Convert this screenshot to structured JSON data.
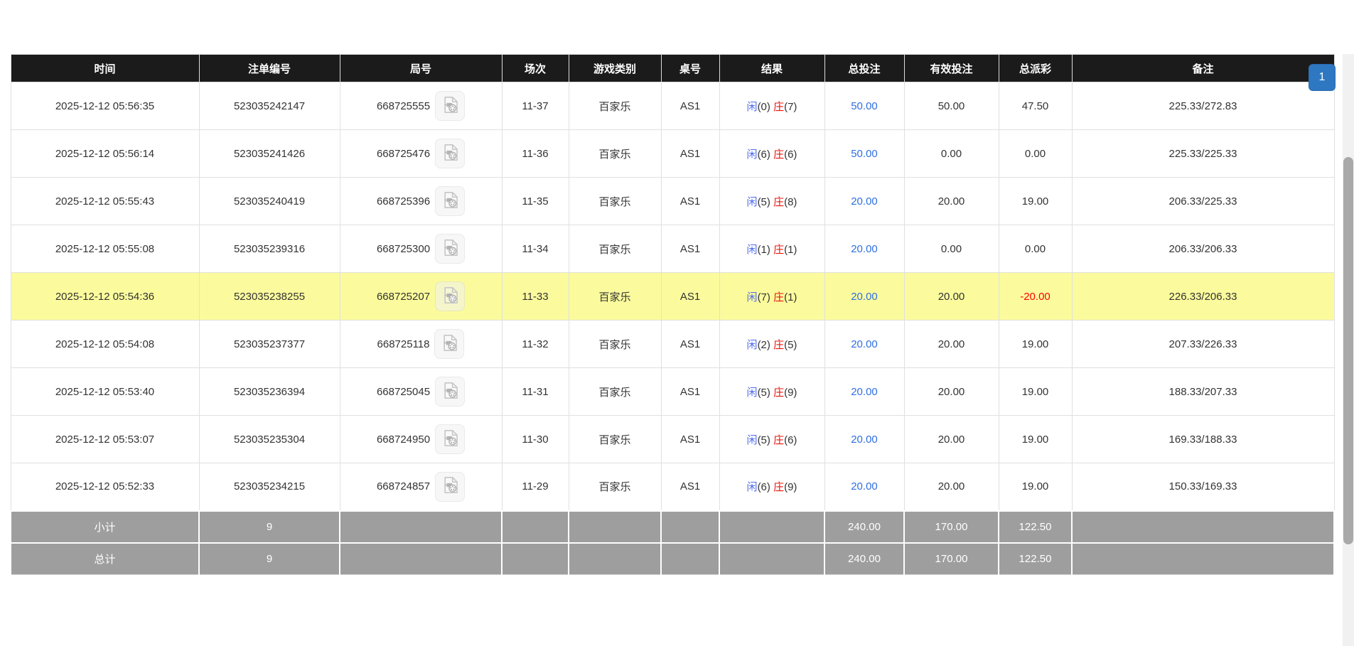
{
  "pagination": {
    "current": "1"
  },
  "table": {
    "headers": [
      "时间",
      "注单编号",
      "局号",
      "场次",
      "游戏类别",
      "桌号",
      "结果",
      "总投注",
      "有效投注",
      "总派彩",
      "备注"
    ],
    "rows": [
      {
        "time": "2025-12-12 05:56:35",
        "bet_id": "523035242147",
        "round_no": "668725555",
        "session": "11-37",
        "game_type": "百家乐",
        "table_no": "AS1",
        "player_label": "闲",
        "player_score": "(0)",
        "banker_label": "庄",
        "banker_score": "(7)",
        "total_bet": "50.00",
        "valid_bet": "50.00",
        "payout": "47.50",
        "payout_negative": false,
        "remark": "225.33/272.83",
        "highlight": false
      },
      {
        "time": "2025-12-12 05:56:14",
        "bet_id": "523035241426",
        "round_no": "668725476",
        "session": "11-36",
        "game_type": "百家乐",
        "table_no": "AS1",
        "player_label": "闲",
        "player_score": "(6)",
        "banker_label": "庄",
        "banker_score": "(6)",
        "total_bet": "50.00",
        "valid_bet": "0.00",
        "payout": "0.00",
        "payout_negative": false,
        "remark": "225.33/225.33",
        "highlight": false
      },
      {
        "time": "2025-12-12 05:55:43",
        "bet_id": "523035240419",
        "round_no": "668725396",
        "session": "11-35",
        "game_type": "百家乐",
        "table_no": "AS1",
        "player_label": "闲",
        "player_score": "(5)",
        "banker_label": "庄",
        "banker_score": "(8)",
        "total_bet": "20.00",
        "valid_bet": "20.00",
        "payout": "19.00",
        "payout_negative": false,
        "remark": "206.33/225.33",
        "highlight": false
      },
      {
        "time": "2025-12-12 05:55:08",
        "bet_id": "523035239316",
        "round_no": "668725300",
        "session": "11-34",
        "game_type": "百家乐",
        "table_no": "AS1",
        "player_label": "闲",
        "player_score": "(1)",
        "banker_label": "庄",
        "banker_score": "(1)",
        "total_bet": "20.00",
        "valid_bet": "0.00",
        "payout": "0.00",
        "payout_negative": false,
        "remark": "206.33/206.33",
        "highlight": false
      },
      {
        "time": "2025-12-12 05:54:36",
        "bet_id": "523035238255",
        "round_no": "668725207",
        "session": "11-33",
        "game_type": "百家乐",
        "table_no": "AS1",
        "player_label": "闲",
        "player_score": "(7)",
        "banker_label": "庄",
        "banker_score": "(1)",
        "total_bet": "20.00",
        "valid_bet": "20.00",
        "payout": "-20.00",
        "payout_negative": true,
        "remark": "226.33/206.33",
        "highlight": true
      },
      {
        "time": "2025-12-12 05:54:08",
        "bet_id": "523035237377",
        "round_no": "668725118",
        "session": "11-32",
        "game_type": "百家乐",
        "table_no": "AS1",
        "player_label": "闲",
        "player_score": "(2)",
        "banker_label": "庄",
        "banker_score": "(5)",
        "total_bet": "20.00",
        "valid_bet": "20.00",
        "payout": "19.00",
        "payout_negative": false,
        "remark": "207.33/226.33",
        "highlight": false
      },
      {
        "time": "2025-12-12 05:53:40",
        "bet_id": "523035236394",
        "round_no": "668725045",
        "session": "11-31",
        "game_type": "百家乐",
        "table_no": "AS1",
        "player_label": "闲",
        "player_score": "(5)",
        "banker_label": "庄",
        "banker_score": "(9)",
        "total_bet": "20.00",
        "valid_bet": "20.00",
        "payout": "19.00",
        "payout_negative": false,
        "remark": "188.33/207.33",
        "highlight": false
      },
      {
        "time": "2025-12-12 05:53:07",
        "bet_id": "523035235304",
        "round_no": "668724950",
        "session": "11-30",
        "game_type": "百家乐",
        "table_no": "AS1",
        "player_label": "闲",
        "player_score": "(5)",
        "banker_label": "庄",
        "banker_score": "(6)",
        "total_bet": "20.00",
        "valid_bet": "20.00",
        "payout": "19.00",
        "payout_negative": false,
        "remark": "169.33/188.33",
        "highlight": false
      },
      {
        "time": "2025-12-12 05:52:33",
        "bet_id": "523035234215",
        "round_no": "668724857",
        "session": "11-29",
        "game_type": "百家乐",
        "table_no": "AS1",
        "player_label": "闲",
        "player_score": "(6)",
        "banker_label": "庄",
        "banker_score": "(9)",
        "total_bet": "20.00",
        "valid_bet": "20.00",
        "payout": "19.00",
        "payout_negative": false,
        "remark": "150.33/169.33",
        "highlight": false
      }
    ],
    "footer": [
      {
        "label": "小计",
        "count": "9",
        "total_bet": "240.00",
        "valid_bet": "170.00",
        "payout": "122.50"
      },
      {
        "label": "总计",
        "count": "9",
        "total_bet": "240.00",
        "valid_bet": "170.00",
        "payout": "122.50"
      }
    ]
  },
  "colors": {
    "header_bg": "#1b1b1b",
    "highlight_row": "#fbfb9d",
    "footer_bg": "#9e9e9e",
    "link_blue": "#2f6fe0",
    "player_blue": "#4f6bed",
    "banker_red": "#e8150c",
    "negative_red": "#ff0000",
    "pagination_blue": "#2e78c2"
  }
}
